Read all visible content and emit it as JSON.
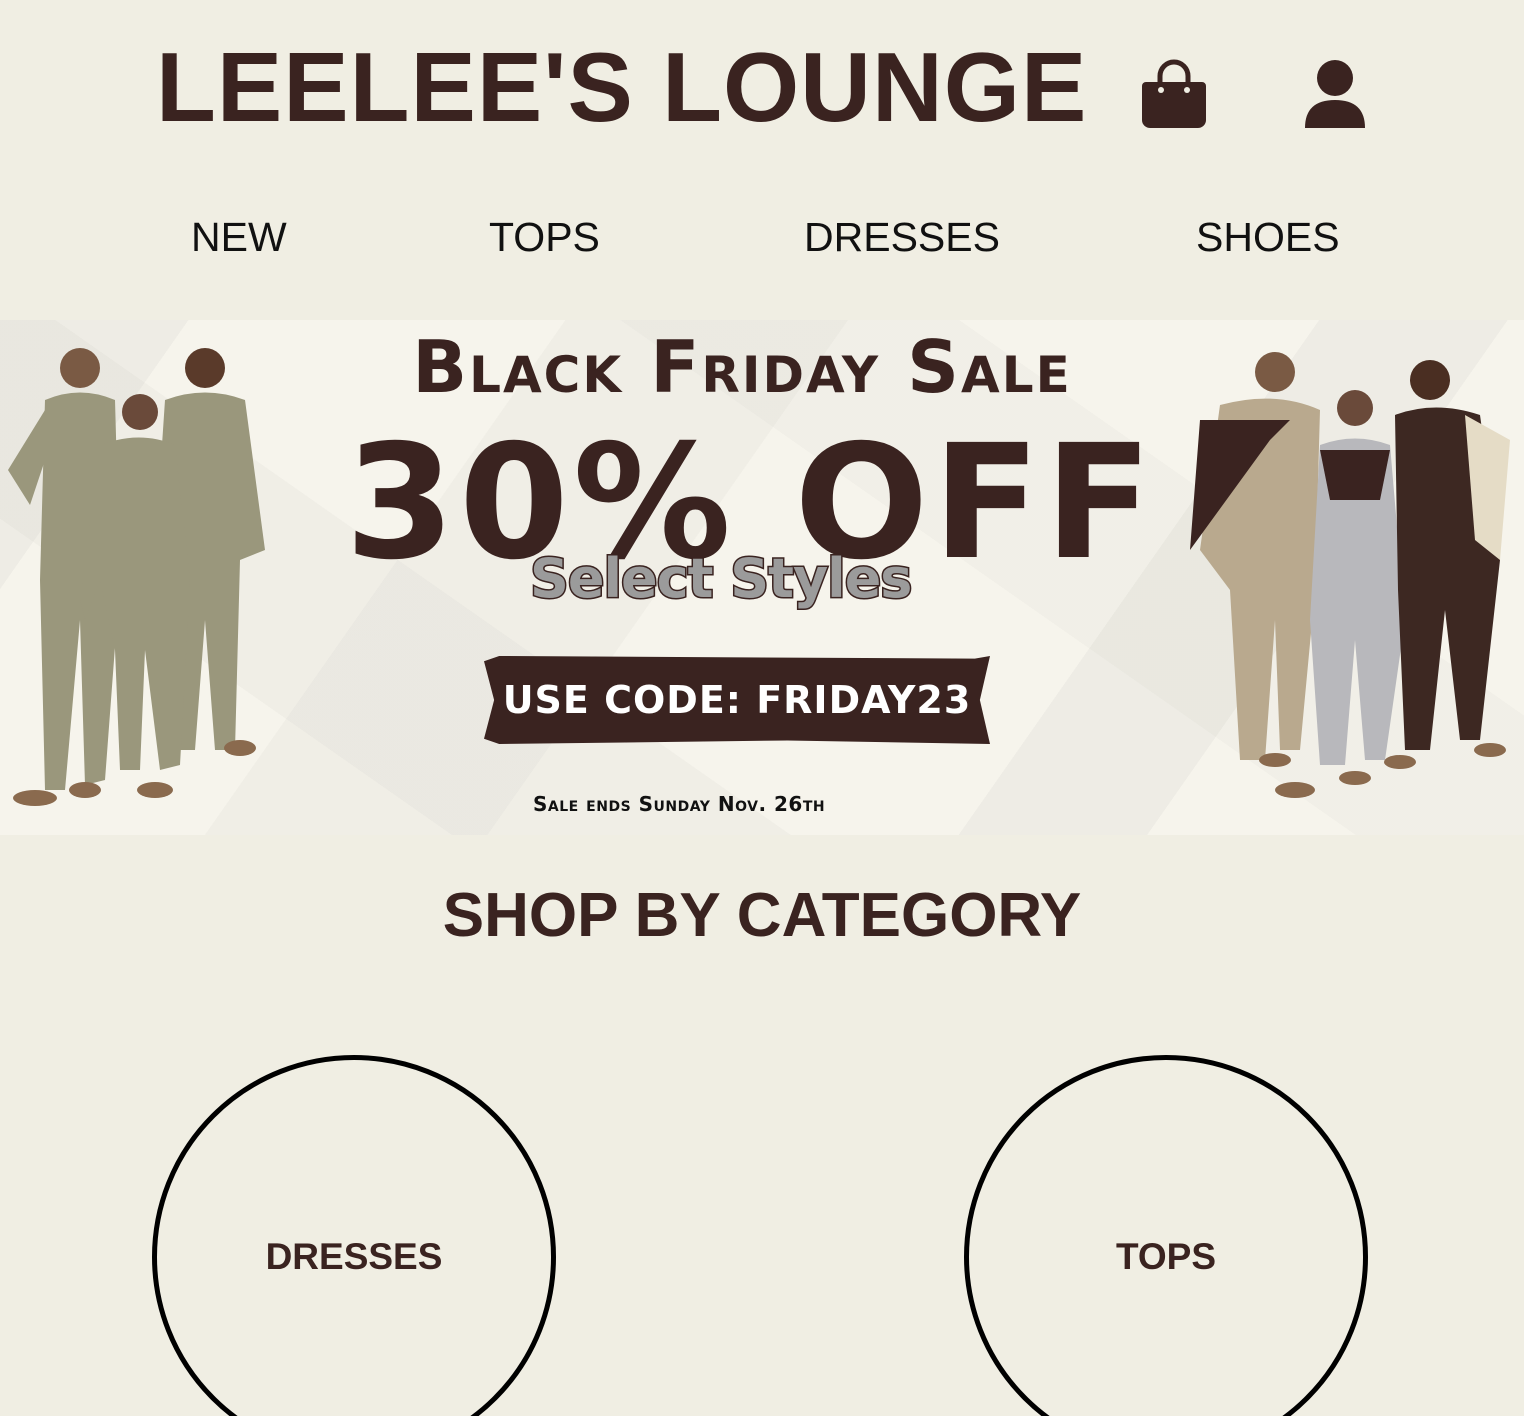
{
  "header": {
    "logo": "LEELEE'S LOUNGE",
    "icons": [
      "shopping-bag-icon",
      "user-icon"
    ]
  },
  "nav": {
    "items": [
      {
        "label": "NEW"
      },
      {
        "label": "TOPS"
      },
      {
        "label": "DRESSES"
      },
      {
        "label": "SHOES"
      }
    ]
  },
  "banner": {
    "title": "Black Friday Sale",
    "discount": "30% OFF",
    "subtitle": "Select Styles",
    "code": "USE CODE: FRIDAY23",
    "ends": "Sale ends Sunday Nov. 26th"
  },
  "category": {
    "title": "SHOP BY CATEGORY",
    "items": [
      {
        "label": "DRESSES"
      },
      {
        "label": "TOPS"
      }
    ]
  },
  "colors": {
    "background": "#f0eee3",
    "brand_brown": "#3a2320",
    "banner_bg": "#f6f4ec"
  }
}
